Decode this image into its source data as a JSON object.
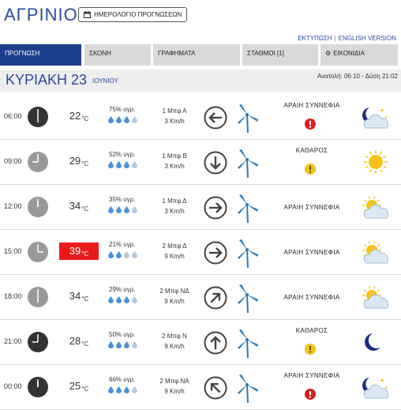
{
  "header": {
    "city": "ΑΓΡΙΝΙΟ",
    "calendar_button": "ΗΜΕΡΟΛΟΓΙΟ ΠΡΟΓΝΩΣΕΩΝ",
    "print_link": "ΕΚΤΥΠΩΣΗ",
    "english_link": "ENGLISH VERSION"
  },
  "tabs": [
    {
      "label": "ΠΡΟΓΝΩΣΗ",
      "active": true
    },
    {
      "label": "ΣΚΟΝΗ"
    },
    {
      "label": "ΓΡΑΦΗΜΑΤΑ"
    },
    {
      "label": "ΣΤΑΘΜΟΙ [1]"
    },
    {
      "label": "ΕΙΚΟΝΙΔΙΑ",
      "icon": "gear-icon"
    }
  ],
  "day": {
    "name": "ΚΥΡΙΑΚΗ 23",
    "month": "ΙΟΥΝΙΟΥ",
    "sun": "Ανατολή: 06:10 - Δύση 21:02"
  },
  "rows": [
    {
      "time": "06:00",
      "night": true,
      "temp": "22",
      "unit": "°C",
      "hot": false,
      "humidity": "75% υγρ.",
      "drops_filled": 3,
      "wind_speed": "1 Μπφ Α",
      "wind_kmh": "3 Km/h",
      "arrow": "left",
      "desc": "ΑΡΑΙΗ ΣΥΝΝΕΦΙΑ",
      "warn": "red",
      "weather": "moon-cloud"
    },
    {
      "time": "09:00",
      "night": false,
      "temp": "29",
      "unit": "°C",
      "hot": false,
      "humidity": "52% υγρ.",
      "drops_filled": 3,
      "wind_speed": "1 Μπφ Β",
      "wind_kmh": "3 Km/h",
      "arrow": "down",
      "desc": "ΚΑΘΑΡΟΣ",
      "warn": "yellow",
      "weather": "sun"
    },
    {
      "time": "12:00",
      "night": false,
      "temp": "34",
      "unit": "°C",
      "hot": false,
      "humidity": "35% υγρ.",
      "drops_filled": 3,
      "wind_speed": "1 Μπφ Δ",
      "wind_kmh": "3 Km/h",
      "arrow": "right",
      "desc": "ΑΡΑΙΗ ΣΥΝΝΕΦΙΑ",
      "warn": "",
      "weather": "sun-cloud"
    },
    {
      "time": "15:00",
      "night": false,
      "temp": "39",
      "unit": "°C",
      "hot": true,
      "humidity": "21% υγρ.",
      "drops_filled": 2,
      "wind_speed": "2 Μπφ Δ",
      "wind_kmh": "9 Km/h",
      "arrow": "right",
      "desc": "ΑΡΑΙΗ ΣΥΝΝΕΦΙΑ",
      "warn": "",
      "weather": "sun-cloud"
    },
    {
      "time": "18:00",
      "night": false,
      "temp": "34",
      "unit": "°C",
      "hot": false,
      "humidity": "29% υγρ.",
      "drops_filled": 3,
      "wind_speed": "2 Μπφ ΝΔ",
      "wind_kmh": "9 Km/h",
      "arrow": "up-right",
      "desc": "ΑΡΑΙΗ ΣΥΝΝΕΦΙΑ",
      "warn": "",
      "weather": "sun-cloud"
    },
    {
      "time": "21:00",
      "night": true,
      "temp": "28",
      "unit": "°C",
      "hot": false,
      "humidity": "50% υγρ.",
      "drops_filled": 3,
      "wind_speed": "2 Μπφ Ν",
      "wind_kmh": "9 Km/h",
      "arrow": "up",
      "desc": "ΚΑΘΑΡΟΣ",
      "warn": "yellow",
      "weather": "moon"
    },
    {
      "time": "00:00",
      "night": true,
      "temp": "25",
      "unit": "°C",
      "hot": false,
      "humidity": "66% υγρ.",
      "drops_filled": 3,
      "wind_speed": "2 Μπφ ΝΑ",
      "wind_kmh": "9 Km/h",
      "arrow": "up-left",
      "desc": "ΑΡΑΙΗ ΣΥΝΝΕΦΙΑ",
      "warn": "red",
      "weather": "moon-cloud"
    }
  ],
  "colors": {
    "accent": "#1d3e8c",
    "hot": "#e81b1b",
    "drop": "#4a90d9"
  }
}
